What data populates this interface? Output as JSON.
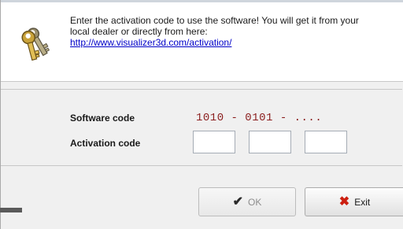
{
  "dialog": {
    "message_line1": "Enter the activation code to use the software! You will get it from your",
    "message_line2": "local dealer or directly from here:",
    "link": "http://www.visualizer3d.com/activation/"
  },
  "form": {
    "software_code_label": "Software code",
    "software_code_value": "1010 - 0101 - ....",
    "activation_code_label": "Activation code",
    "activation_fields": [
      "",
      "",
      ""
    ]
  },
  "buttons": {
    "ok_label": "OK",
    "exit_label": "Exit"
  },
  "icons": {
    "header": "keys-icon",
    "ok": "checkmark-icon",
    "exit": "x-icon"
  },
  "colors": {
    "code_text": "#8b1e1e",
    "exit_icon": "#cc1f10",
    "link": "#0000c8"
  }
}
